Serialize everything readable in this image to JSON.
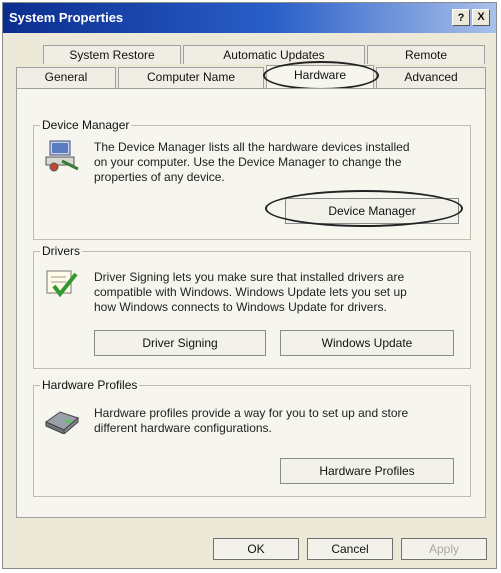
{
  "window": {
    "title": "System Properties",
    "help_label": "?",
    "close_label": "X"
  },
  "tabs": {
    "row1": [
      {
        "label": "System Restore"
      },
      {
        "label": "Automatic Updates"
      },
      {
        "label": "Remote"
      }
    ],
    "row2": [
      {
        "label": "General"
      },
      {
        "label": "Computer Name"
      },
      {
        "label": "Hardware",
        "selected": true
      },
      {
        "label": "Advanced"
      }
    ]
  },
  "device_manager": {
    "heading": "Device Manager",
    "lines": [
      "The Device Manager lists all the hardware devices installed",
      "on your computer. Use the Device Manager to change the",
      "properties of any device."
    ],
    "button": "Device Manager",
    "icon": "device-manager-icon"
  },
  "drivers": {
    "heading": "Drivers",
    "lines": [
      "Driver Signing lets you make sure that installed drivers are",
      "compatible with Windows. Windows Update lets you set up",
      "how Windows connects to Windows Update for drivers."
    ],
    "signing_button": "Driver Signing",
    "update_button": "Windows Update",
    "icon": "driver-signing-icon"
  },
  "hardware_profiles": {
    "heading": "Hardware Profiles",
    "lines": [
      "Hardware profiles provide a way for you to set up and store",
      "different hardware configurations."
    ],
    "button": "Hardware Profiles",
    "icon": "hardware-profiles-icon"
  },
  "footer": {
    "ok": "OK",
    "cancel": "Cancel",
    "apply": "Apply"
  },
  "colors": {
    "title_bar": "#0b2d8f",
    "dialog_bg": "#ece9d8"
  }
}
